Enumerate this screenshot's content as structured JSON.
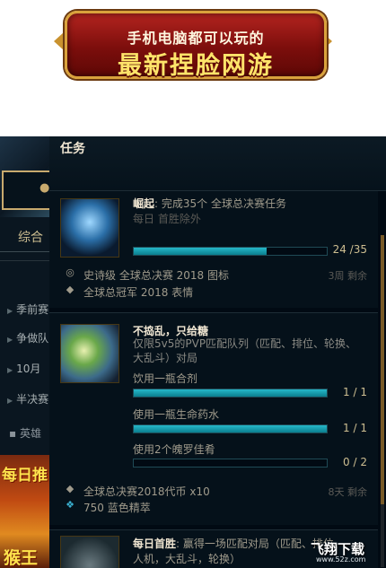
{
  "banner": {
    "line1": "手机电脑都可以玩的",
    "line2": "最新捏脸网游"
  },
  "sidebar": {
    "tab": "综合",
    "items": [
      {
        "label": "季前赛"
      },
      {
        "label": "争做队"
      },
      {
        "label": "10月"
      },
      {
        "label": "半决赛"
      }
    ],
    "chat": "英雄",
    "ad_line1": "每日推",
    "ad_line2": "猴王"
  },
  "panel": {
    "title": "任务"
  },
  "quests": [
    {
      "title_strong": "崛起",
      "title_rest": ": 完成35个 全球总决赛任务",
      "subtitle": "每日 首胜除外",
      "objectives": [
        {
          "label": "",
          "count": "24 /35",
          "progress": 0.69
        }
      ],
      "rewards": [
        {
          "icon": "user-icon",
          "label": "史诗级 全球总决赛 2018 图标"
        },
        {
          "icon": "location-pin-icon",
          "label": "全球总冠军 2018 表情"
        }
      ],
      "time": "3周 剩余"
    },
    {
      "title_strong": "不捣乱，只给糖",
      "subtitle": "仅限5v5的PVP匹配队列（匹配、排位、轮换、大乱斗）对局",
      "objectives": [
        {
          "label": "饮用一瓶合剂",
          "count": "1 / 1",
          "progress": 1.0
        },
        {
          "label": "使用一瓶生命药水",
          "count": "1 / 1",
          "progress": 1.0
        },
        {
          "label": "使用2个魄罗佳肴",
          "count": "0 / 2",
          "progress": 0.0
        }
      ],
      "rewards": [
        {
          "icon": "location-pin-icon",
          "label": "全球总决赛2018代币 x10"
        },
        {
          "icon": "blue-essence-icon",
          "label": "750 蓝色精萃"
        }
      ],
      "time": "8天 剩余"
    },
    {
      "title_strong": "每日首胜",
      "title_rest": ": 赢得一场匹配对局（匹配、排位、",
      "subtitle": "人机，大乱斗，轮换）"
    }
  ],
  "watermark": {
    "text": "飞翔下载",
    "url": "www.52z.com"
  },
  "colors": {
    "progress_fill": "#26b8c9",
    "gold": "#c8aa6e",
    "background": "#010a13"
  }
}
